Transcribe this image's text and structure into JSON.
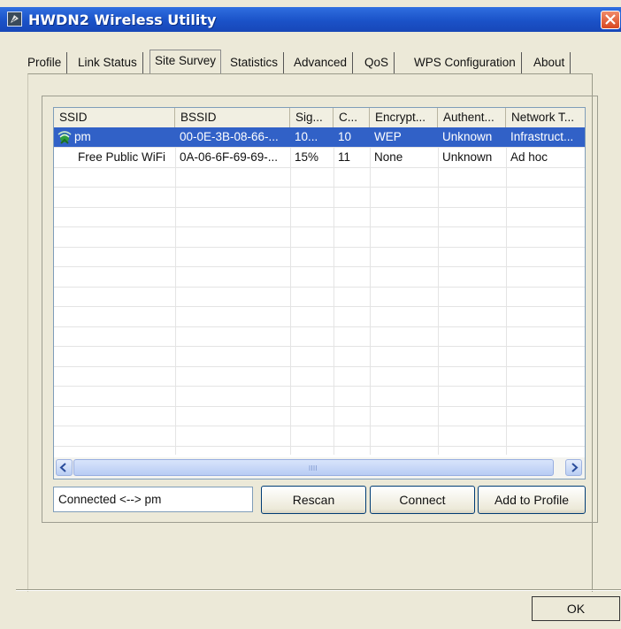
{
  "window": {
    "title": "HWDN2 Wireless Utility"
  },
  "tabs": [
    {
      "label": "Profile"
    },
    {
      "label": "Link Status"
    },
    {
      "label": "Site Survey",
      "active": true
    },
    {
      "label": "Statistics"
    },
    {
      "label": "Advanced"
    },
    {
      "label": "QoS"
    },
    {
      "label": "WPS Configuration"
    },
    {
      "label": "About"
    }
  ],
  "table": {
    "columns": [
      "SSID",
      "BSSID",
      "Sig...",
      "C...",
      "Encrypt...",
      "Authent...",
      "Network T..."
    ],
    "rows": [
      {
        "ssid": "pm",
        "bssid": "00-0E-3B-08-66-...",
        "signal": "10...",
        "channel": "10",
        "encryption": "WEP",
        "auth": "Unknown",
        "network_type": "Infrastruct...",
        "selected": true,
        "icon": "wireless-network-icon"
      },
      {
        "ssid": "Free Public WiFi",
        "bssid": "0A-06-6F-69-69-...",
        "signal": "15%",
        "channel": "11",
        "encryption": "None",
        "auth": "Unknown",
        "network_type": "Ad hoc",
        "selected": false
      }
    ]
  },
  "status": {
    "text": "Connected <--> pm"
  },
  "buttons": {
    "rescan": "Rescan",
    "connect": "Connect",
    "add_to_profile": "Add to Profile",
    "ok": "OK"
  },
  "colors": {
    "title_bar": "#1b52c8",
    "selection": "#3161c7",
    "close_button": "#d8471f"
  }
}
